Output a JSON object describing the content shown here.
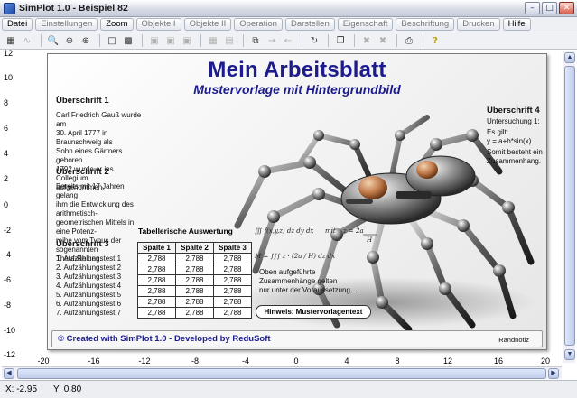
{
  "window": {
    "title": "SimPlot 1.0 - Beispiel 82"
  },
  "menu": [
    {
      "label": "Datei",
      "enabled": true
    },
    {
      "label": "Einstellungen",
      "enabled": false
    },
    {
      "label": "Zoom",
      "enabled": true
    },
    {
      "label": "Objekte I",
      "enabled": false
    },
    {
      "label": "Objekte II",
      "enabled": false
    },
    {
      "label": "Operation",
      "enabled": false
    },
    {
      "label": "Darstellen",
      "enabled": false
    },
    {
      "label": "Eigenschaft",
      "enabled": false
    },
    {
      "label": "Beschriftung",
      "enabled": false
    },
    {
      "label": "Drucken",
      "enabled": false
    },
    {
      "label": "Hilfe",
      "enabled": true
    }
  ],
  "axes": {
    "y_ticks": [
      "12",
      "10",
      "8",
      "6",
      "4",
      "2",
      "0",
      "-2",
      "-4",
      "-6",
      "-8",
      "-10",
      "-12"
    ],
    "x_ticks": [
      "-20",
      "-16",
      "-12",
      "-8",
      "-4",
      "0",
      "4",
      "8",
      "12",
      "16",
      "20"
    ]
  },
  "sheet": {
    "title": "Mein Arbeitsblatt",
    "subtitle": "Mustervorlage mit Hintergrundbild",
    "section1": {
      "heading": "Überschrift 1",
      "lines": [
        "Carl Friedrich Gauß wurde am",
        "30. April 1777 in Braunschweig als",
        "Sohn eines Gärtners geboren.",
        "1792 wurde er ins Collegium",
        "aufgenommen."
      ]
    },
    "section2": {
      "heading": "Überschrift 2",
      "lines": [
        "Bereits mit 17 Jahren gelang",
        "ihm die Entwicklung des arithmetisch-",
        "geometrischen Mittels in eine Potenz-",
        "reihe vom Typus der sogenannten",
        "Theta-Reihen."
      ]
    },
    "section3": {
      "heading": "Überschrift 3",
      "items": [
        "1. Aufzählungstest 1",
        "2. Aufzählungstest 2",
        "3. Aufzählungstest 3",
        "4. Aufzählungstest 4",
        "5. Aufzählungstest 5",
        "6. Aufzählungstest 6",
        "7. Aufzählungstest 7"
      ]
    },
    "section4": {
      "heading": "Überschrift 4",
      "lines": [
        "Untersuchung 1:",
        "Es gilt:",
        "y = a+b*sin(x)",
        "Somit besteht ein",
        "Zusammenhang."
      ]
    },
    "table": {
      "caption": "Tabellerische Auswertung",
      "headers": [
        "Spalte 1",
        "Spalte 2",
        "Spalte 3"
      ],
      "rows": [
        [
          "2,788",
          "2,788",
          "2,788"
        ],
        [
          "2,788",
          "2,788",
          "2,788"
        ],
        [
          "2,788",
          "2,788",
          "2,788"
        ],
        [
          "2,788",
          "2,788",
          "2,788"
        ],
        [
          "2,788",
          "2,788",
          "2,788"
        ],
        [
          "2,788",
          "2,788",
          "2,788"
        ]
      ]
    },
    "note_lines": [
      "Oben aufgeführte",
      "Zusammenhänge gelten",
      "nur unter der Voraussetzung ..."
    ],
    "hint": "Hinweis: Mustervorlagentext",
    "footer_credit": "© Created with SimPlot 1.0 - Developed by ReduSoft",
    "footer_note": "Randnotiz"
  },
  "status": {
    "x": "X: -2.95",
    "y": "Y: 0.80"
  }
}
